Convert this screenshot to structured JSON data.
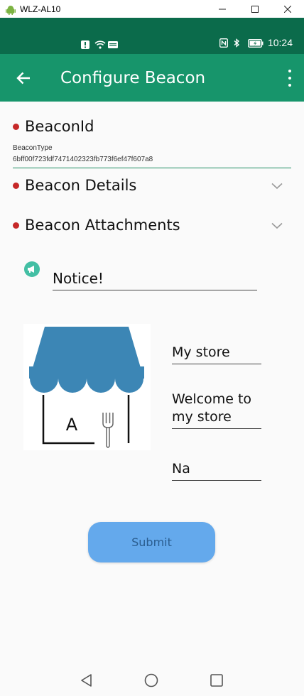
{
  "window": {
    "title": "WLZ-AL10",
    "controls": [
      "minimize",
      "maximize",
      "close"
    ]
  },
  "status_bar": {
    "time": "10:24",
    "icons": [
      "alert-icon",
      "wifi-icon",
      "data-icon",
      "nfc-icon",
      "bluetooth-icon",
      "battery-icon"
    ]
  },
  "app_bar": {
    "title": "Configure Beacon",
    "back_icon": "arrow-left-icon",
    "menu_icon": "more-vert-icon",
    "color": "#17956b"
  },
  "sections": {
    "beacon_id": {
      "title": "BeaconId",
      "type_label": "BeaconType",
      "value": "6bff00f723fdf7471402323fb773f6ef47f607a8"
    },
    "beacon_details": {
      "title": "Beacon Details"
    },
    "beacon_attachments": {
      "title": "Beacon Attachments"
    }
  },
  "attachment": {
    "notice_value": "Notice!",
    "store_name": "My store",
    "welcome_text": "Welcome to my store",
    "extra_value": "Na",
    "image_letter": "A"
  },
  "submit_label": "Submit",
  "accent_colors": {
    "bullet": "#c62828",
    "submit": "#64a9ec",
    "notice_icon": "#43bfa4"
  }
}
